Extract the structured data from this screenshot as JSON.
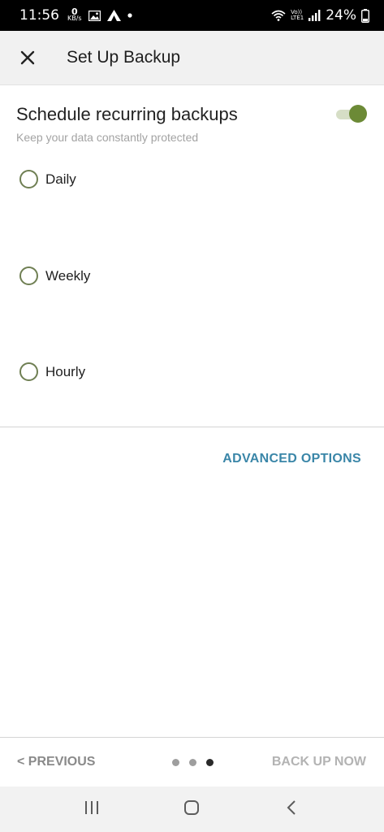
{
  "status_bar": {
    "time": "11:56",
    "kbs_value": "0",
    "kbs_unit": "KB/s",
    "volte_top": "Vo))",
    "volte_bottom": "LTE1",
    "battery": "24%"
  },
  "app_bar": {
    "title": "Set Up Backup"
  },
  "schedule": {
    "title": "Schedule recurring backups",
    "subtitle": "Keep your data constantly protected",
    "enabled": true
  },
  "options": [
    {
      "label": "Daily",
      "selected": false
    },
    {
      "label": "Weekly",
      "selected": false
    },
    {
      "label": "Hourly",
      "selected": false
    }
  ],
  "advanced_label": "ADVANCED OPTIONS",
  "bottom_nav": {
    "previous_label": "< PREVIOUS",
    "backup_label": "BACK UP NOW",
    "page_count": 3,
    "active_page": 3
  },
  "colors": {
    "accent_green": "#6c8a36",
    "link_blue": "#3a86a8"
  }
}
